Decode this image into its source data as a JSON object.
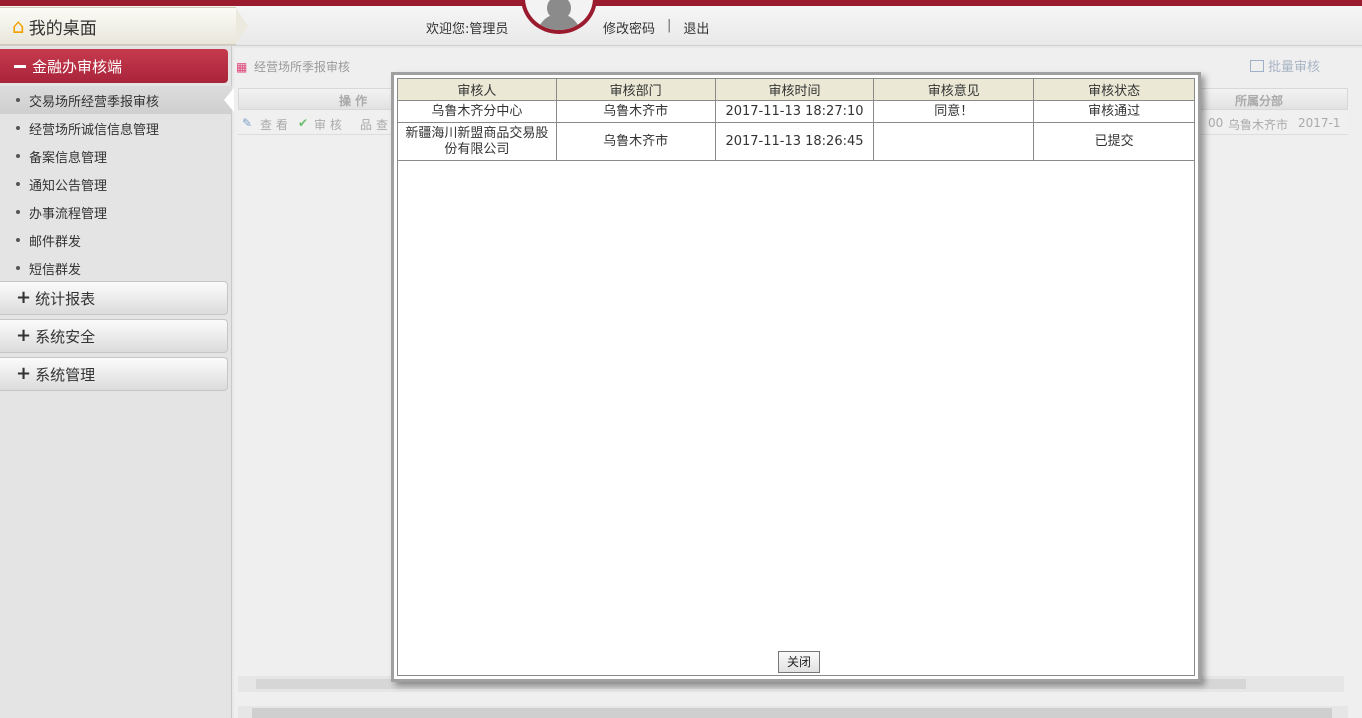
{
  "header": {
    "desk_label": "我的桌面",
    "welcome": "欢迎您:管理员",
    "change_password": "修改密码",
    "separator": "|",
    "logout": "退出"
  },
  "sidebar": {
    "active_section": "金融办审核端",
    "items": [
      {
        "label": "交易场所经营季报审核",
        "active": true
      },
      {
        "label": "经营场所诚信信息管理"
      },
      {
        "label": "备案信息管理"
      },
      {
        "label": "通知公告管理"
      },
      {
        "label": "办事流程管理"
      },
      {
        "label": "邮件群发"
      },
      {
        "label": "短信群发"
      }
    ],
    "sections": [
      {
        "label": "统计报表"
      },
      {
        "label": "系统安全"
      },
      {
        "label": "系统管理"
      }
    ]
  },
  "main": {
    "breadcrumb": "经营场所季报审核",
    "batch_label": "批量审核",
    "grid_headers": {
      "ops": "操 作",
      "branch": "所属分部"
    },
    "row": {
      "view": "查 看",
      "audit": "审 核",
      "more": "查",
      "num_tail": "00",
      "branch": "乌鲁木齐市",
      "date_cut": "2017-1"
    }
  },
  "modal": {
    "columns": [
      "审核人",
      "审核部门",
      "审核时间",
      "审核意见",
      "审核状态"
    ],
    "rows": [
      {
        "auditor": "乌鲁木齐分中心",
        "dept": "乌鲁木齐市",
        "time": "2017-11-13 18:27:10",
        "opinion": "同意！",
        "status": "审核通过"
      },
      {
        "auditor": "新疆海川新盟商品交易股份有限公司",
        "dept": "乌鲁木齐市",
        "time": "2017-11-13 18:26:45",
        "opinion": "",
        "status": "已提交"
      }
    ],
    "close_label": "关闭"
  },
  "colors": {
    "brand_red": "#9b1b2e",
    "active_section_bg": "#b32d42",
    "table_header_bg": "#ebe9d5"
  }
}
